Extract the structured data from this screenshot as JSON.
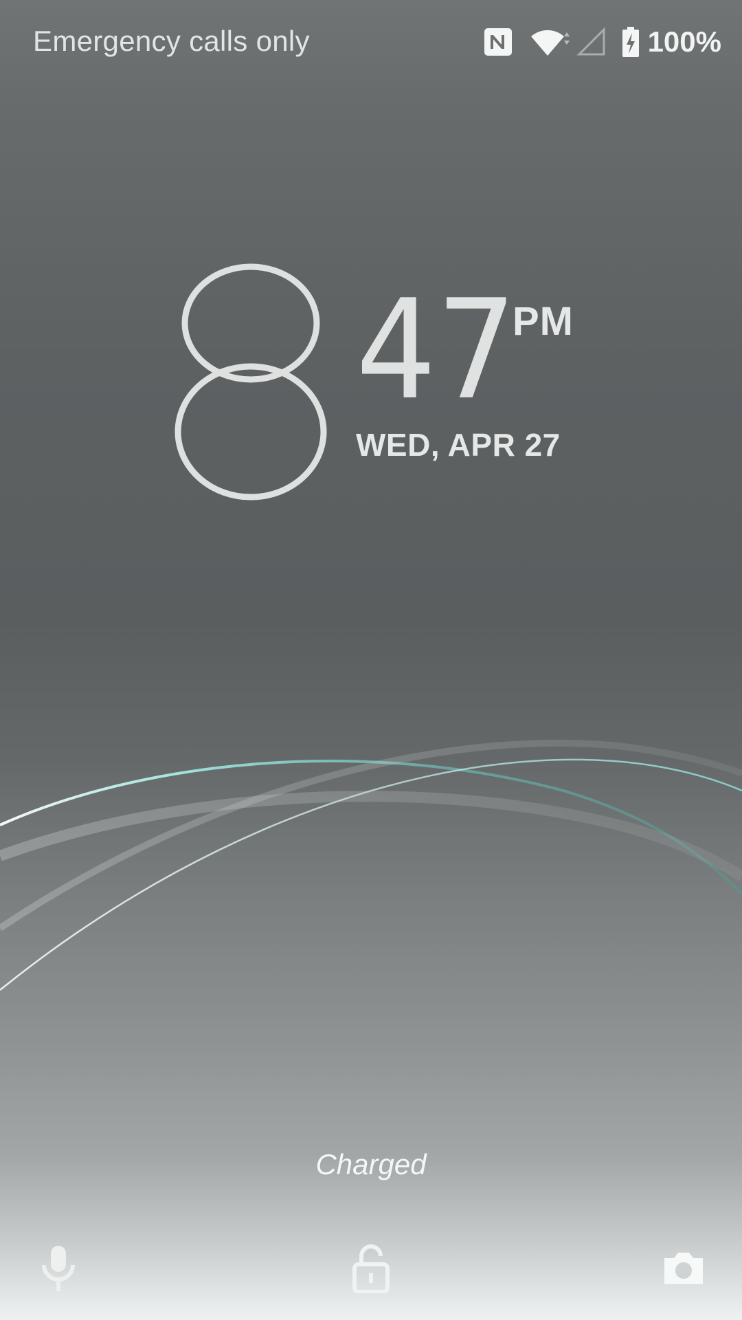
{
  "status_bar": {
    "carrier_text": "Emergency calls only",
    "battery_percent": "100%",
    "icons": [
      "nfc-icon",
      "wifi-icon",
      "cellular-signal-icon",
      "battery-charging-icon"
    ]
  },
  "clock": {
    "hour": "8",
    "minutes": "47",
    "ampm": "PM",
    "date": "WED, APR 27"
  },
  "charge_status": "Charged",
  "shortcuts": {
    "left": "microphone-icon",
    "center": "unlock-icon",
    "right": "camera-icon"
  },
  "colors": {
    "text": "#e6e8e8",
    "accent_teal": "#8fe3dc"
  }
}
